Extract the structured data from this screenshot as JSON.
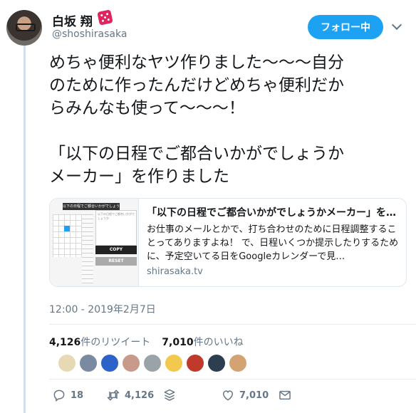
{
  "author": {
    "name": "白坂 翔",
    "handle": "@shoshirasaka"
  },
  "follow_button": {
    "label": "フォロー中"
  },
  "tweet": {
    "text": "めちゃ便利なヤツ作りました〜〜〜自分\nのために作ったんだけどめちゃ便利だか\nらみんなも使って〜〜〜！\n\n「以下の日程でご都合いかがでしょうか\nメーカー」を作りました",
    "timestamp": "12:00 - 2019年2月7日"
  },
  "card": {
    "title": "「以下の日程でご都合いかがでしょうかメーカー」を…",
    "description": "お仕事のメールとかで、打ち合わせのために日程調整することってありますよね！ で、日程いくつか提示したりするために、予定空いてる日をGoogleカレンダーで見…",
    "domain": "shirasaka.tv",
    "thumbnail": {
      "header": "以下の日程でご都合いかがでしょうかメーカー",
      "box_text": "以下の日程でご都合いかがでしょうか",
      "copy_label": "COPY",
      "reset_label": "RESET"
    }
  },
  "stats": {
    "retweets_count": "4,126",
    "retweets_label": "件のリツイート",
    "likes_count": "7,010",
    "likes_label": "件のいいね"
  },
  "liker_colors": [
    "#e8d9b5",
    "#7a8aa0",
    "#2b63c9",
    "#c79a8c",
    "#9aa3a8",
    "#f2c94c",
    "#c0392b",
    "#2c3e50",
    "#d4a373"
  ],
  "actions": {
    "reply_count": "18",
    "retweet_count": "4,126",
    "like_count": "7,010"
  },
  "colors": {
    "accent": "#1da1f2",
    "text": "#14171a",
    "muted": "#657786",
    "thread_line": "#c7e3f5"
  }
}
